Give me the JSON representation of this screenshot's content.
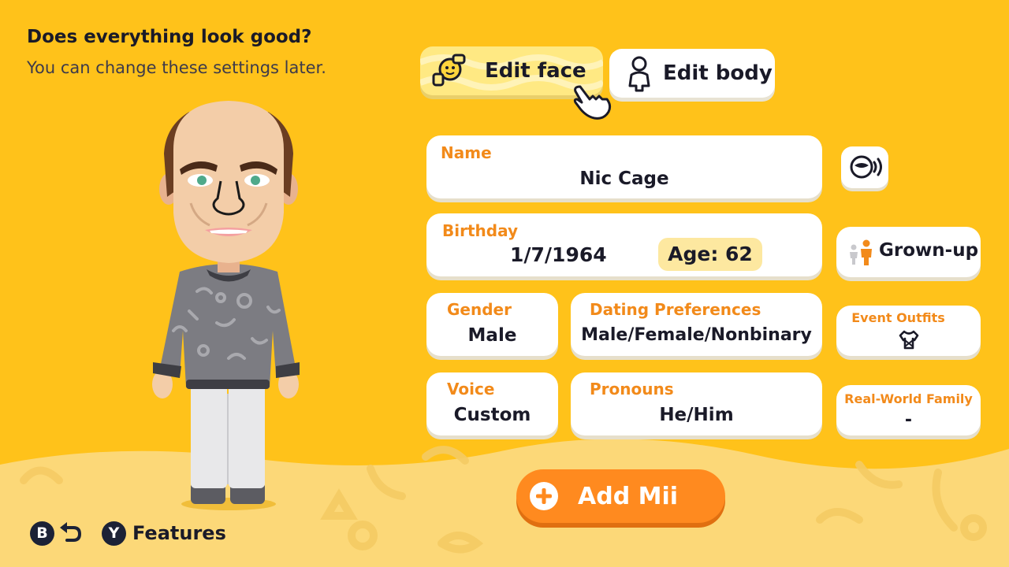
{
  "header": {
    "title": "Does everything look good?",
    "subtitle": "You can change these settings later."
  },
  "tabs": {
    "edit_face": "Edit face",
    "edit_body": "Edit body",
    "selected": "edit_face"
  },
  "fields": {
    "name_label": "Name",
    "name_value": "Nic Cage",
    "birthday_label": "Birthday",
    "birthday_value": "1/7/1964",
    "age_value": "Age: 62",
    "gender_label": "Gender",
    "gender_value": "Male",
    "dating_label": "Dating Preferences",
    "dating_value": "Male/Female/Nonbinary",
    "voice_label": "Voice",
    "voice_value": "Custom",
    "pronouns_label": "Pronouns",
    "pronouns_value": "He/Him"
  },
  "side": {
    "grown_up_label": "Grown-up",
    "event_outfits_label": "Event Outfits",
    "family_label": "Real-World Family",
    "family_value": "-"
  },
  "actions": {
    "add_mii_label": "Add Mii"
  },
  "footer": {
    "b_button": "B",
    "y_button": "Y",
    "features_label": "Features"
  },
  "colors": {
    "background": "#FFC21A",
    "accent_orange": "#FF8A1F",
    "label_orange": "#F28A1A",
    "selected_tab": "#FFE983",
    "dark": "#1C2236"
  },
  "icons": [
    "baby-face-icon",
    "body-figure-icon",
    "pointer-hand-icon",
    "voice-speak-icon",
    "grown-up-icon",
    "outfit-icon",
    "plus-icon",
    "back-arrow-icon"
  ]
}
